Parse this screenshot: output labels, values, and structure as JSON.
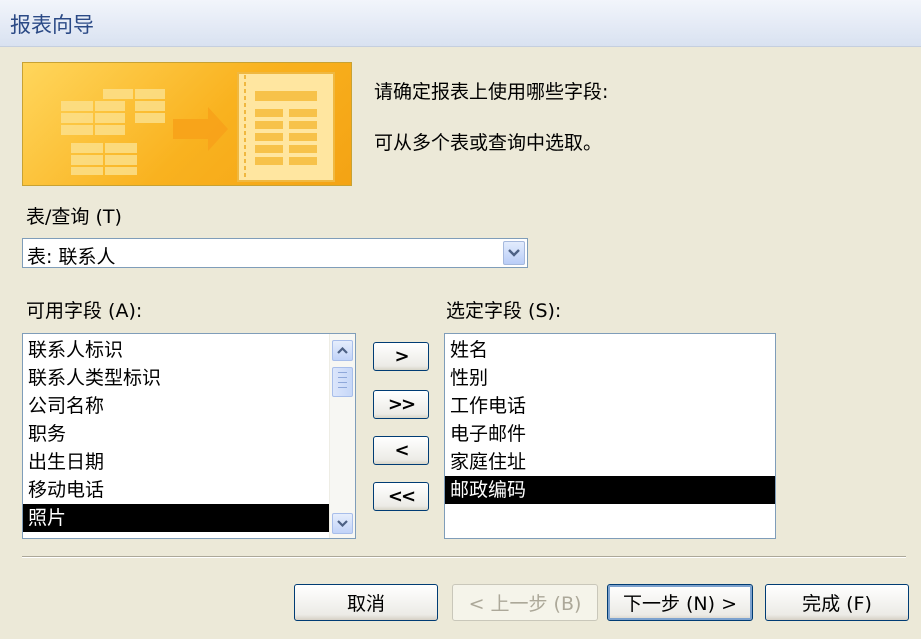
{
  "window": {
    "title": "报表向导"
  },
  "instructions": {
    "line1": "请确定报表上使用哪些字段:",
    "line2": "可从多个表或查询中选取。"
  },
  "table_query": {
    "label": "表/查询 (T)",
    "selected": "表: 联系人"
  },
  "available_fields": {
    "label": "可用字段 (A):",
    "items": [
      "联系人标识",
      "联系人类型标识",
      "公司名称",
      "职务",
      "出生日期",
      "移动电话",
      "照片"
    ],
    "selected_item": "照片"
  },
  "selected_fields": {
    "label": "选定字段 (S):",
    "items": [
      "姓名",
      "性别",
      "工作电话",
      "电子邮件",
      "家庭住址",
      "邮政编码"
    ],
    "selected_item": "邮政编码"
  },
  "move_buttons": {
    "add_one": ">",
    "add_all": ">>",
    "remove_one": "<",
    "remove_all": "<<"
  },
  "footer_buttons": {
    "cancel": "取消",
    "back": "< 上一步 (B)",
    "next": "下一步 (N) >",
    "finish": "完成 (F)"
  },
  "colors": {
    "selection": "#000000",
    "background": "#ECE9D8",
    "title_text": "#2B4A86"
  }
}
